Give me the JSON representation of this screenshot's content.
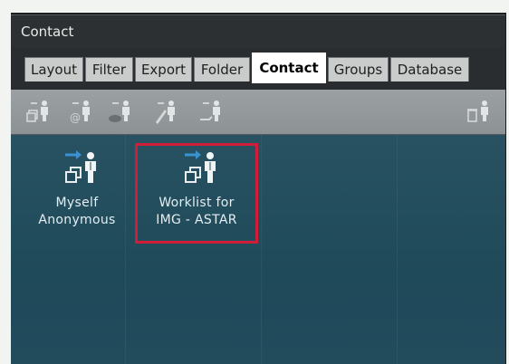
{
  "window": {
    "title": "Contact"
  },
  "tabs": [
    {
      "label": "Layout",
      "active": false
    },
    {
      "label": "Filter",
      "active": false
    },
    {
      "label": "Export",
      "active": false
    },
    {
      "label": "Folder",
      "active": false
    },
    {
      "label": "Contact",
      "active": true
    },
    {
      "label": "Groups",
      "active": false
    },
    {
      "label": "Database",
      "active": false
    }
  ],
  "toolbar": {
    "buttons": [
      {
        "icon": "new-contact-icon"
      },
      {
        "icon": "contact-email-icon"
      },
      {
        "icon": "contact-network-icon"
      },
      {
        "icon": "edit-contact-icon"
      },
      {
        "icon": "import-contact-icon"
      },
      {
        "icon": "delete-contact-icon"
      }
    ]
  },
  "contacts": [
    {
      "line1": "Myself",
      "line2": "Anonymous",
      "icon": "contact-worklist-icon",
      "selected": false
    },
    {
      "line1": "Worklist for",
      "line2": "IMG - ASTAR",
      "icon": "contact-worklist-icon",
      "selected": true
    }
  ],
  "colors": {
    "selection": "#d01e3a",
    "content_bg": "#224b5c",
    "icon_blue": "#3c92d0"
  }
}
